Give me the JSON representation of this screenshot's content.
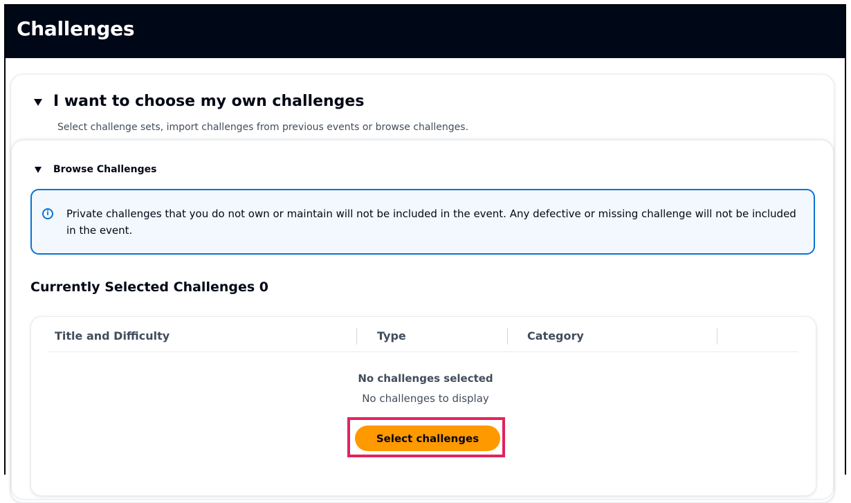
{
  "header": {
    "title": "Challenges"
  },
  "choose_section": {
    "title": "I want to choose my own challenges",
    "description": "Select challenge sets, import challenges from previous events or browse challenges."
  },
  "browse_section": {
    "title": "Browse Challenges",
    "alert": {
      "icon": "info-icon",
      "text": "Private challenges that you do not own or maintain will not be included in the event. Any defective or missing challenge will not be included in the event."
    }
  },
  "selected": {
    "title": "Currently Selected Challenges 0",
    "columns": [
      "Title and Difficulty",
      "Type",
      "Category"
    ],
    "empty_title": "No challenges selected",
    "empty_description": "No challenges to display",
    "button_label": "Select challenges"
  },
  "colors": {
    "topbar": "#000716",
    "accent_blue": "#0972d3",
    "primary_button": "#ff9900",
    "highlight": "#e0245e"
  }
}
